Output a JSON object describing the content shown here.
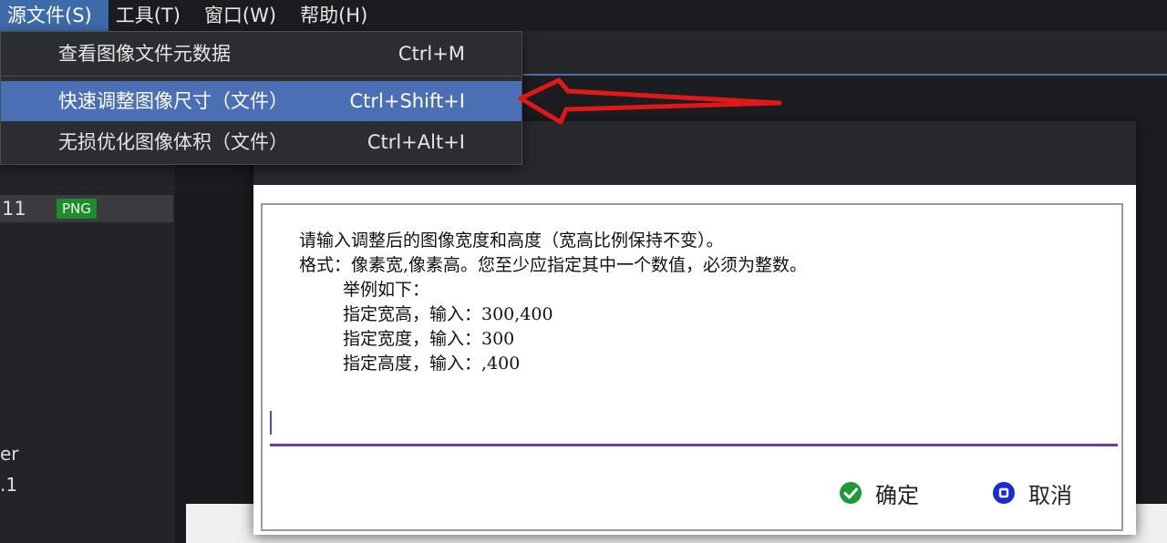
{
  "menubar": {
    "items": [
      {
        "label": "源文件(S)",
        "active": true
      },
      {
        "label": "工具(T)",
        "active": false
      },
      {
        "label": "窗口(W)",
        "active": false
      },
      {
        "label": "帮助(H)",
        "active": false
      }
    ]
  },
  "dropdown": {
    "items": [
      {
        "label": "查看图像文件元数据",
        "shortcut": "Ctrl+M"
      },
      {
        "label": "快速调整图像尺寸（文件）",
        "shortcut": "Ctrl+Shift+I",
        "highlighted": true
      },
      {
        "label": "无损优化图像体积（文件）",
        "shortcut": "Ctrl+Alt+I"
      }
    ]
  },
  "filelist": {
    "row_number": "11",
    "badge": "PNG",
    "side_text_1": "er",
    "side_text_2": ".1"
  },
  "dialog": {
    "prompt_lines": [
      "请输入调整后的图像宽度和高度（宽高比例保持不变）。",
      "格式：像素宽,像素高。您至少应指定其中一个数值，必须为整数。",
      "举例如下：",
      "指定宽高，输入：300,400",
      "指定宽度，输入：300",
      "指定高度，输入：,400"
    ],
    "input_value": "",
    "ok_label": "确定",
    "cancel_label": "取消"
  },
  "colors": {
    "accent": "#4a6fb5",
    "input_underline": "#6a3fa0",
    "ok_icon": "#1e9a3a",
    "cancel_icon": "#1a2bd6",
    "annotation_arrow": "#e01818"
  }
}
